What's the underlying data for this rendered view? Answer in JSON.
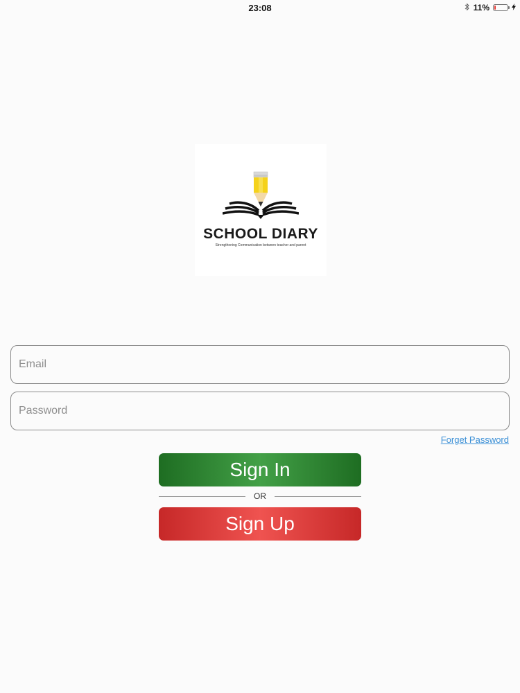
{
  "status_bar": {
    "time": "23:08",
    "battery_percent": "11%",
    "battery_level": 0.11,
    "icons": [
      "bluetooth-icon",
      "battery-icon",
      "charging-bolt-icon"
    ]
  },
  "logo": {
    "title": "SCHOOL DIARY",
    "tagline": "Strengthening Communication between teacher and parent"
  },
  "form": {
    "email_placeholder": "Email",
    "email_value": "",
    "password_placeholder": "Password",
    "password_value": "",
    "forgot_label": "Forget Password",
    "signin_label": "Sign In",
    "or_label": "OR",
    "signup_label": "Sign Up"
  },
  "colors": {
    "signin_green": "#2e7d32",
    "signup_red": "#d32f2f",
    "link_blue": "#3a8fd6",
    "battery_low": "#e53935"
  }
}
